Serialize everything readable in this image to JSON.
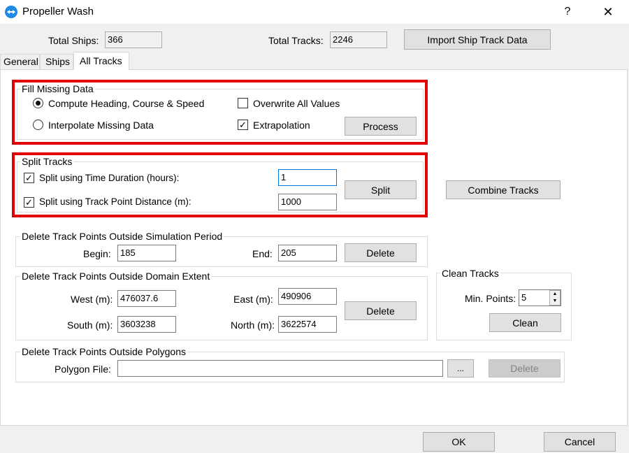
{
  "window": {
    "title": "Propeller Wash",
    "help_label": "?",
    "close_label": "✕"
  },
  "header": {
    "total_ships_label": "Total Ships:",
    "total_ships_value": "366",
    "total_tracks_label": "Total Tracks:",
    "total_tracks_value": "2246",
    "import_button": "Import Ship Track Data"
  },
  "tabs": [
    {
      "label": "General"
    },
    {
      "label": "Ships"
    },
    {
      "label": "All Tracks",
      "active": true
    }
  ],
  "fill_missing": {
    "title": "Fill Missing Data",
    "option_compute": "Compute Heading, Course & Speed",
    "option_interpolate": "Interpolate Missing Data",
    "overwrite_label": "Overwrite All Values",
    "extrapolation_label": "Extrapolation",
    "check_mark": "✓",
    "process_button": "Process"
  },
  "split_tracks": {
    "title": "Split Tracks",
    "time_label": "Split using Time Duration (hours):",
    "time_value": "1",
    "distance_label": "Split using Track Point Distance (m):",
    "distance_value": "1000",
    "split_button": "Split",
    "combine_button": "Combine Tracks"
  },
  "sim_period": {
    "title": "Delete Track Points Outside Simulation Period",
    "begin_label": "Begin:",
    "begin_value": "185",
    "end_label": "End:",
    "end_value": "205",
    "delete_button": "Delete"
  },
  "domain_extent": {
    "title": "Delete Track Points Outside Domain Extent",
    "west_label": "West (m):",
    "west_value": "476037.6",
    "east_label": "East (m):",
    "east_value": "490906",
    "south_label": "South (m):",
    "south_value": "3603238",
    "north_label": "North (m):",
    "north_value": "3622574",
    "delete_button": "Delete"
  },
  "clean_tracks": {
    "title": "Clean Tracks",
    "min_points_label": "Min. Points:",
    "min_points_value": "5",
    "spin_up": "▲",
    "spin_down": "▼",
    "clean_button": "Clean"
  },
  "polygons": {
    "title": "Delete Track Points Outside Polygons",
    "file_label": "Polygon File:",
    "file_value": "",
    "browse_button": "...",
    "delete_button": "Delete"
  },
  "footer": {
    "ok_button": "OK",
    "cancel_button": "Cancel"
  }
}
